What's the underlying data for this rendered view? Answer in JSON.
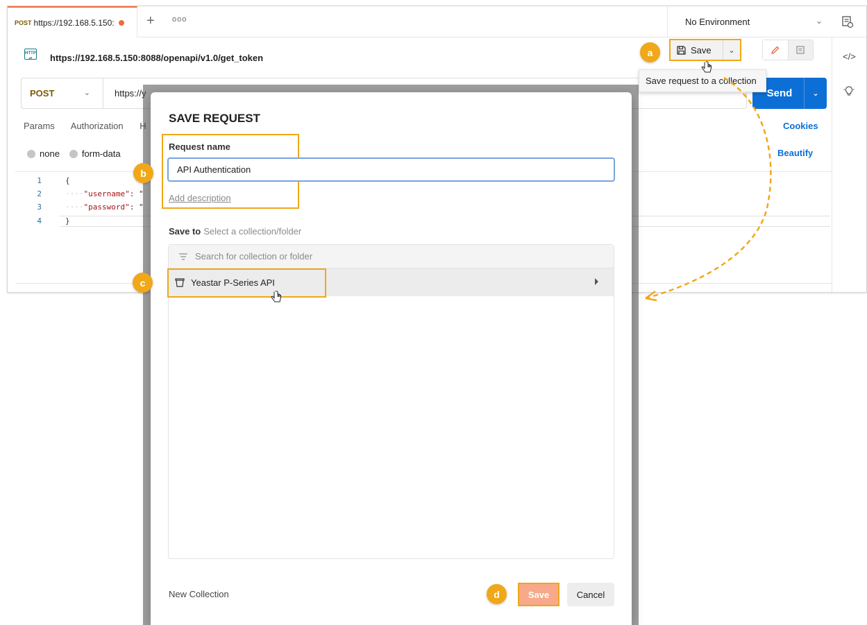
{
  "tabs": {
    "active_method": "POST",
    "active_title": "https://192.168.5.150:",
    "plus": "+",
    "more": "ooo"
  },
  "environment": {
    "label": "No Environment"
  },
  "request": {
    "title": "https://192.168.5.150:8088/openapi/v1.0/get_token",
    "method": "POST",
    "url": "https://y"
  },
  "toolbar": {
    "save_label": "Save",
    "send_label": "Send",
    "tooltip": "Save request to a collection"
  },
  "req_tabs": {
    "params": "Params",
    "authorization": "Authorization",
    "headers_partial": "H"
  },
  "cookies": "Cookies",
  "body_options": {
    "none": "none",
    "form_data": "form-data"
  },
  "beautify": "Beautify",
  "editor": {
    "lines": [
      "1",
      "2",
      "3",
      "4"
    ],
    "open_brace": "{",
    "close_brace": "}",
    "key_username": "\"username\"",
    "key_password": "\"password\"",
    "colon_u": ": \"",
    "colon_p": ": \""
  },
  "dialog": {
    "title": "SAVE REQUEST",
    "request_name_label": "Request name",
    "request_name_value": "API Authentication",
    "add_description": "Add description",
    "save_to_label": "Save to",
    "save_to_hint": "Select a collection/folder",
    "search_placeholder": "Search for collection or folder",
    "collection_name": "Yeastar P-Series API",
    "new_collection": "New Collection",
    "save_label": "Save",
    "cancel_label": "Cancel"
  },
  "annotations": {
    "a": "a",
    "b": "b",
    "c": "c",
    "d": "d"
  },
  "colors": {
    "accent_orange": "#f0a818",
    "send_blue": "#0c6fd6",
    "tab_indicator": "#f26b3a",
    "dialog_save_bg": "#f7a98a"
  },
  "icons": [
    "http-icon",
    "save-disk-icon",
    "chevron-down-icon",
    "pencil-icon",
    "comment-icon",
    "code-icon",
    "lightbulb-icon",
    "environment-icon",
    "filter-icon",
    "collection-icon",
    "caret-right-icon",
    "hand-cursor-icon"
  ]
}
